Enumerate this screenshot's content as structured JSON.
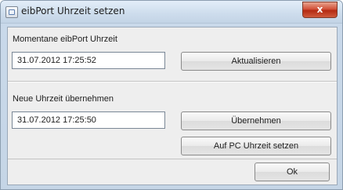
{
  "window": {
    "title": "eibPort Uhrzeit setzen",
    "close_glyph": "x",
    "icon": "app-window-icon"
  },
  "current_section": {
    "label": "Momentane eibPort Uhrzeit",
    "time_value": "31.07.2012 17:25:52",
    "refresh_label": "Aktualisieren"
  },
  "new_section": {
    "label": "Neue Uhrzeit übernehmen",
    "time_value": "31.07.2012 17:25:50",
    "apply_label": "Übernehmen",
    "pc_time_label": "Auf PC Uhrzeit setzen"
  },
  "footer": {
    "ok_label": "Ok"
  },
  "colors": {
    "title_bar": "#cddcec",
    "close_button": "#c9452a",
    "panel": "#eeeeee"
  }
}
